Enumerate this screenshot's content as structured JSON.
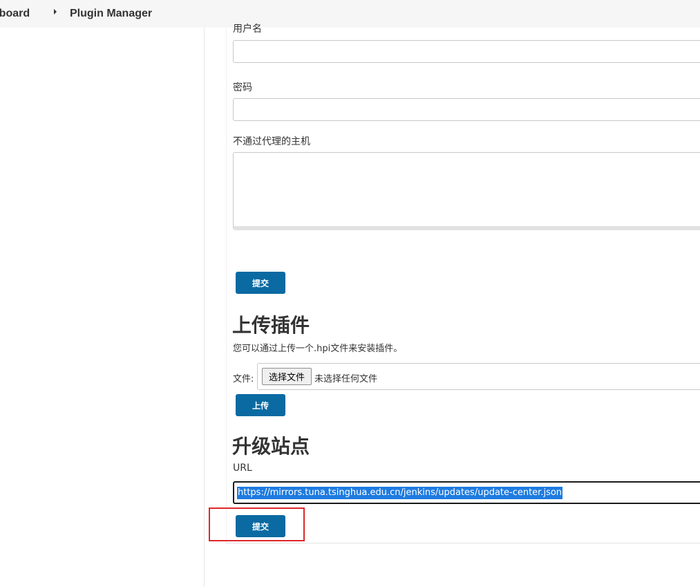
{
  "breadcrumb": {
    "first": "shboard",
    "second": "Plugin Manager"
  },
  "proxy": {
    "username_label": "用户名",
    "password_label": "密码",
    "no_proxy_label": "不通过代理的主机",
    "submit_label": "提交"
  },
  "upload": {
    "title": "上传插件",
    "description": "您可以通过上传一个.hpi文件来安装插件。",
    "file_label": "文件:",
    "choose_button": "选择文件",
    "no_file_text": "未选择任何文件",
    "upload_label": "上传"
  },
  "update_site": {
    "title": "升级站点",
    "url_label": "URL",
    "url_value": "https://mirrors.tuna.tsinghua.edu.cn/jenkins/updates/update-center.json",
    "submit_label": "提交"
  },
  "colors": {
    "button": "#0b6aa2",
    "highlight": "#e0262b",
    "selection": "#1e7be0"
  }
}
